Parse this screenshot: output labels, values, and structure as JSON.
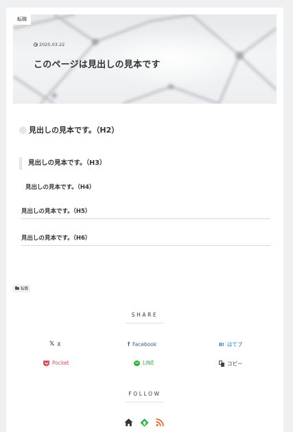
{
  "hero": {
    "category_badge": "転職",
    "date": "2025.03.22",
    "title": "このページは見出しの見本です"
  },
  "headings": {
    "h2": "見出しの見本です。（H2）",
    "h3": "見出しの見本です。（H3）",
    "h4": "見出しの見本です。（H4）",
    "h5": "見出しの見本です。（H5）",
    "h6": "見出しの見本です。（H6）"
  },
  "category_tag": "転職",
  "share": {
    "label": "SHARE",
    "buttons": [
      {
        "name": "x",
        "label": "X",
        "icon": "x-icon",
        "color": "#333333"
      },
      {
        "name": "facebook",
        "label": "Facebook",
        "icon": "facebook-icon",
        "color": "#3b5998"
      },
      {
        "name": "hatena",
        "label": "はてブ",
        "icon": "hatena-bookmark-icon",
        "color": "#1e74c8"
      },
      {
        "name": "pocket",
        "label": "Pocket",
        "icon": "pocket-icon",
        "color": "#e04a5a"
      },
      {
        "name": "line",
        "label": "LINE",
        "icon": "line-icon",
        "color": "#29b634"
      },
      {
        "name": "copy",
        "label": "コピー",
        "icon": "copy-icon",
        "color": "#444444"
      }
    ],
    "icon_glyphs": {
      "x": "𝕏",
      "facebook": "f",
      "hatena": "B!"
    }
  },
  "follow": {
    "label": "FOLLOW",
    "icons": [
      {
        "name": "home-icon",
        "color": "#333333"
      },
      {
        "name": "feedly-icon",
        "color": "#2bb24c"
      },
      {
        "name": "rss-icon",
        "color": "#f26522"
      }
    ]
  }
}
